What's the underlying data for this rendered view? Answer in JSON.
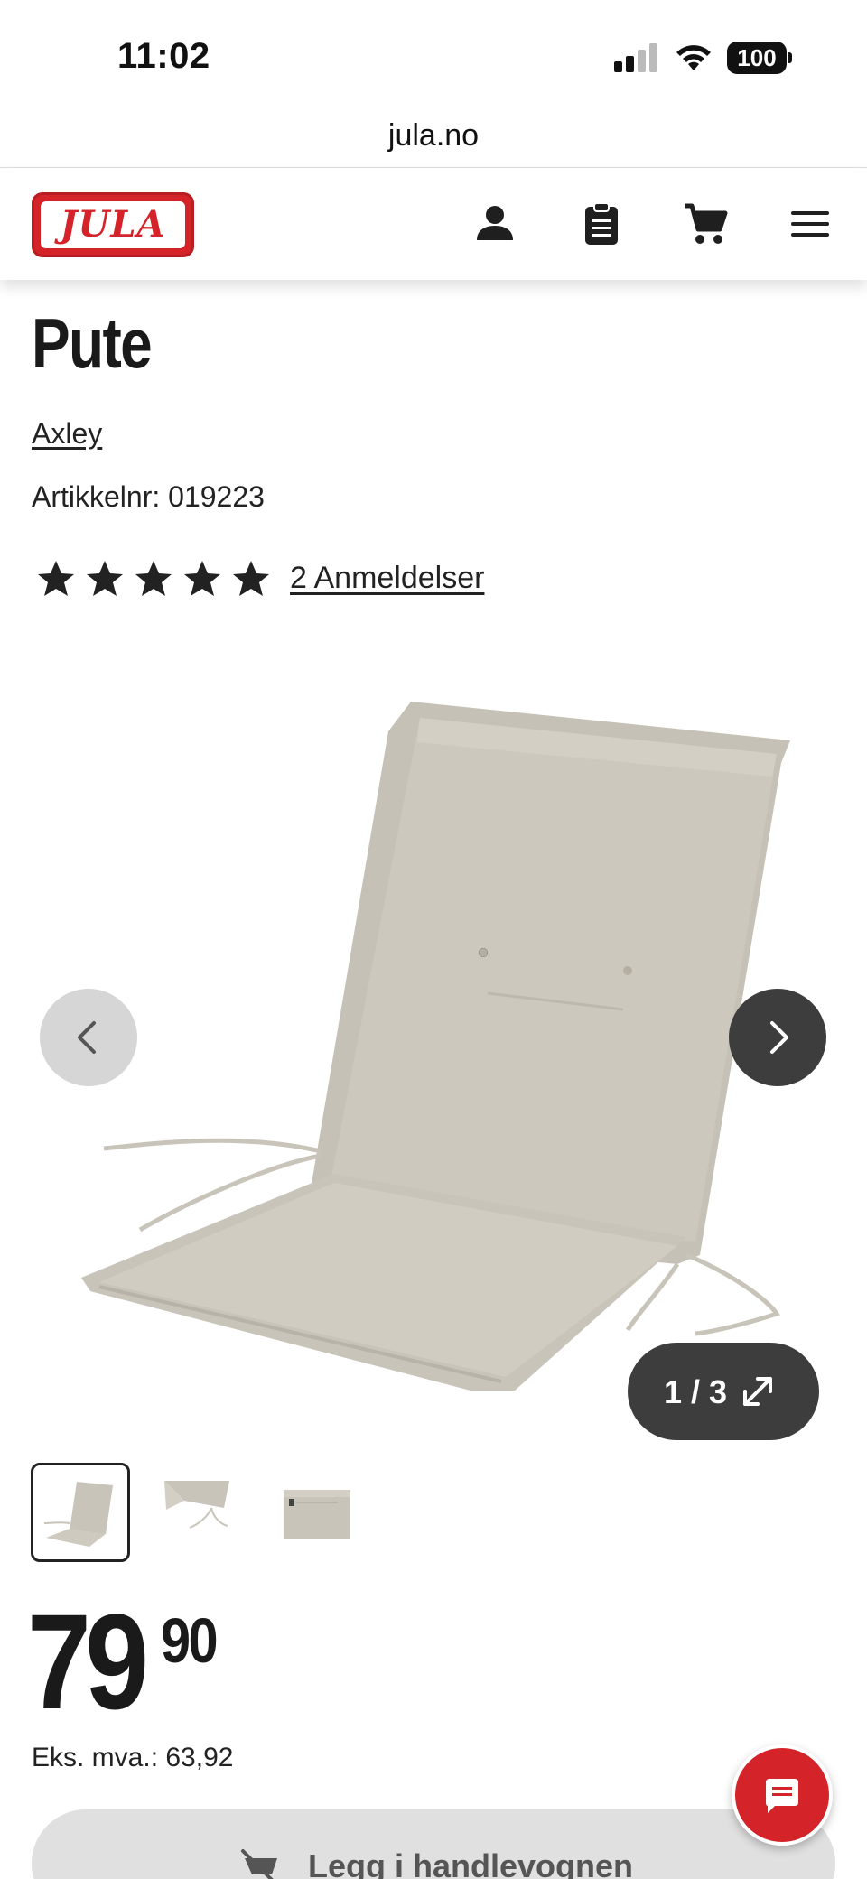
{
  "status_bar": {
    "time": "11:02",
    "battery": "100"
  },
  "browser": {
    "url": "jula.no"
  },
  "header": {
    "logo_text": "JULA",
    "icons": [
      "account-icon",
      "shopping-list-icon",
      "cart-icon",
      "menu-icon"
    ]
  },
  "product": {
    "title": "Pute",
    "brand": "Axley",
    "article_number": "Artikkelnr: 019223",
    "rating": 5,
    "reviews_label": "2 Anmeldelser"
  },
  "gallery": {
    "counter": "1 / 3",
    "current_index": 1,
    "total": 3,
    "thumbnails": [
      "thumbnail-1",
      "thumbnail-2",
      "thumbnail-3"
    ]
  },
  "price": {
    "main": "79",
    "decimals": "90",
    "ex_vat_label": "Eks. mva.: 63,92"
  },
  "cart_button": {
    "label": "Legg i handlevognen"
  },
  "colors": {
    "brand_red": "#d4242a",
    "dark_button": "#3d3d3d",
    "cushion": "#c9c4ba"
  }
}
